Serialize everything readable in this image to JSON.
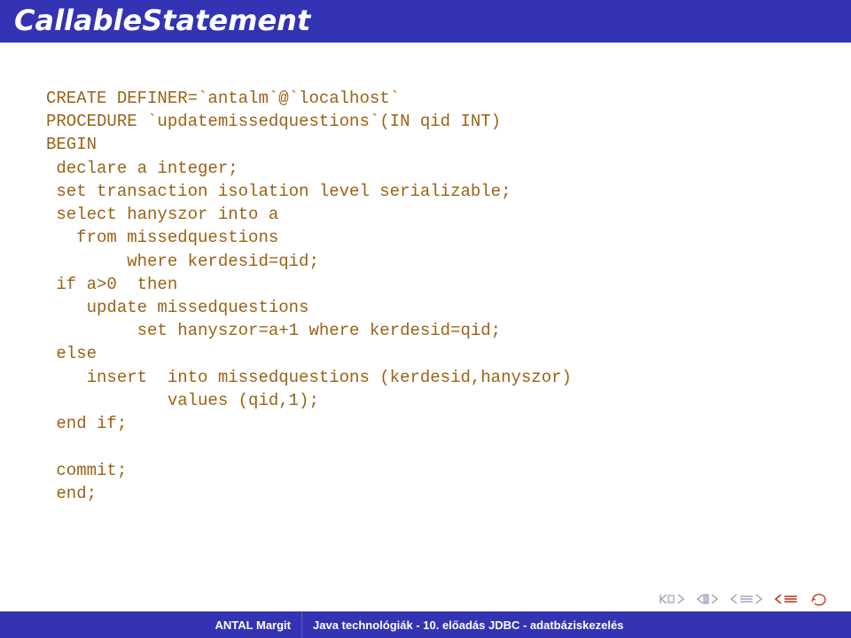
{
  "title": "CallableStatement",
  "code": "CREATE DEFINER=`antalm`@`localhost`\nPROCEDURE `updatemissedquestions`(IN qid INT)\nBEGIN\n declare a integer;\n set transaction isolation level serializable;\n select hanyszor into a\n   from missedquestions\n        where kerdesid=qid;\n if a>0  then\n    update missedquestions\n         set hanyszor=a+1 where kerdesid=qid;\n else\n    insert  into missedquestions (kerdesid,hanyszor)\n            values (qid,1);\n end if;\n\n commit;\n end;",
  "footer": {
    "author": "ANTAL Margit",
    "topic": "Java technológiák -    10. előadás JDBC - adatbáziskezelés"
  }
}
